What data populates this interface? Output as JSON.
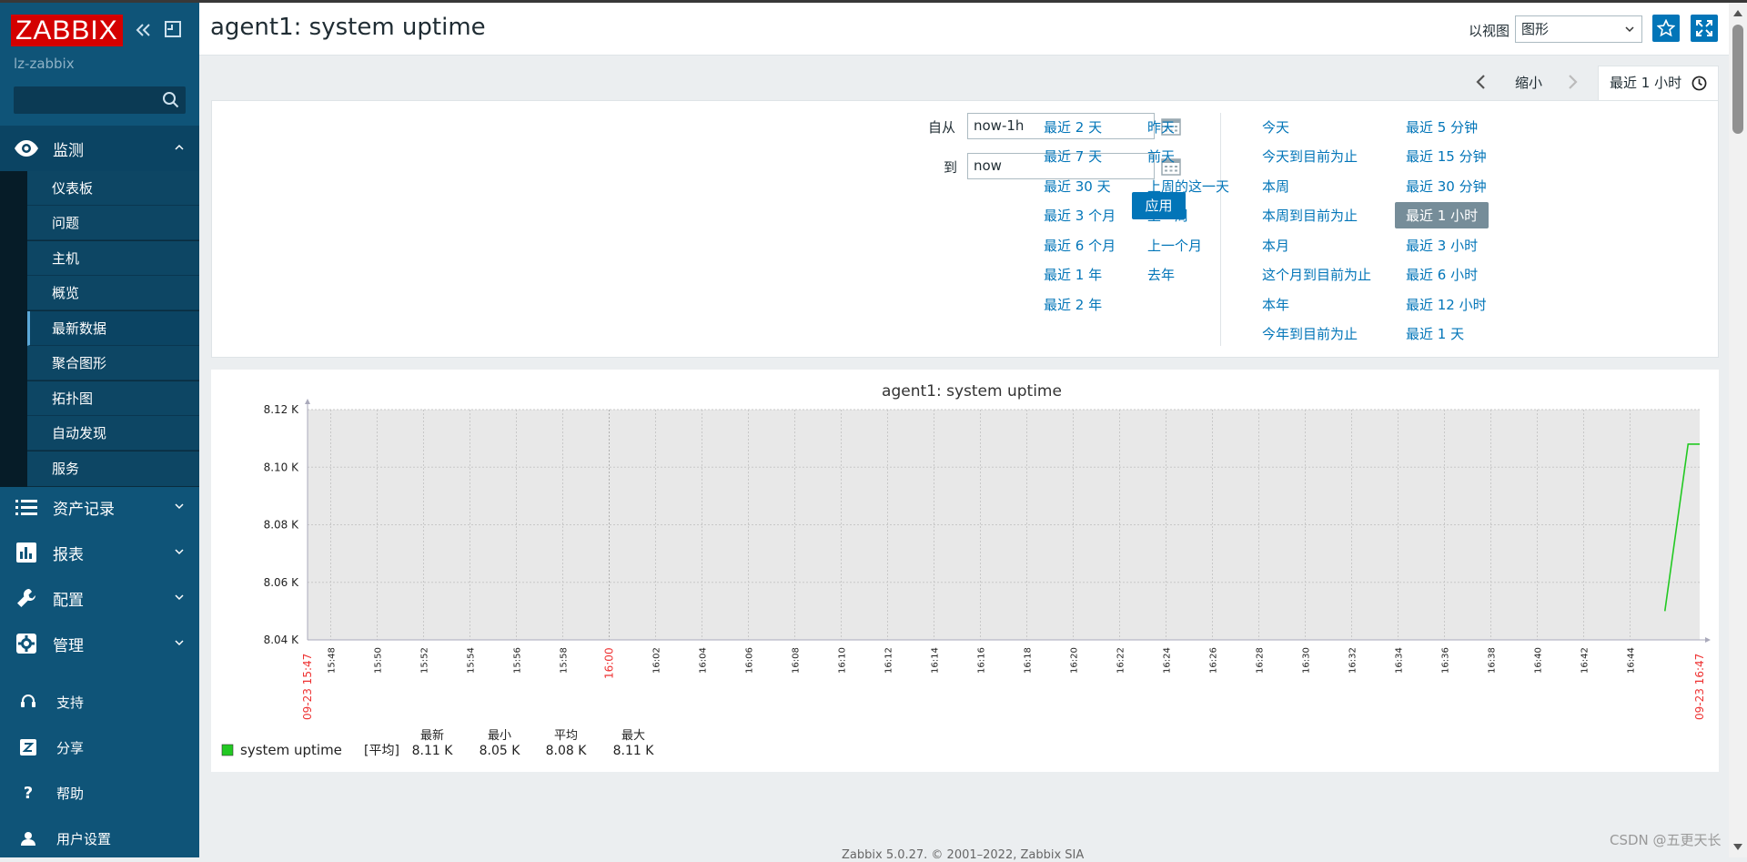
{
  "app": {
    "logo": "ZABBIX",
    "server_name": "lz-zabbix",
    "search_value": ""
  },
  "nav": {
    "monitoring": {
      "label": "监测",
      "items": [
        "仪表板",
        "问题",
        "主机",
        "概览",
        "最新数据",
        "聚合图形",
        "拓扑图",
        "自动发现",
        "服务"
      ],
      "selected": "最新数据"
    },
    "inventory": "资产记录",
    "reports": "报表",
    "config": "配置",
    "admin": "管理",
    "support": "支持",
    "share": "分享",
    "help": "帮助",
    "user_settings": "用户设置"
  },
  "header": {
    "title": "agent1: system uptime",
    "view_as_label": "以视图",
    "view_as_value": "图形"
  },
  "time_tab": {
    "zoom_out": "缩小",
    "range": "最近 1 小时"
  },
  "time_filter": {
    "from_label": "自从",
    "from_value": "now-1h",
    "to_label": "到",
    "to_value": "now",
    "apply": "应用",
    "quick": [
      [
        "最近 2 天",
        "最近 7 天",
        "最近 30 天",
        "最近 3 个月",
        "最近 6 个月",
        "最近 1 年",
        "最近 2 年"
      ],
      [
        "昨天",
        "前天",
        "上周的这一天",
        "上一周",
        "上一个月",
        "去年"
      ],
      [
        "今天",
        "今天到目前为止",
        "本周",
        "本周到目前为止",
        "本月",
        "这个月到目前为止",
        "本年",
        "今年到目前为止"
      ],
      [
        "最近 5 分钟",
        "最近 15 分钟",
        "最近 30 分钟",
        "最近 1 小时",
        "最近 3 小时",
        "最近 6 小时",
        "最近 12 小时",
        "最近 1 天"
      ]
    ],
    "selected_quick": "最近 1 小时"
  },
  "chart_data": {
    "type": "line",
    "title": "agent1: system uptime",
    "y_unit": "K",
    "ylim": [
      8.04,
      8.12
    ],
    "y_ticks": [
      "8.12 K",
      "8.10 K",
      "8.08 K",
      "8.06 K",
      "8.04 K"
    ],
    "x_range": [
      "15:47",
      "16:47"
    ],
    "x_ticks": [
      "15:48",
      "15:50",
      "15:52",
      "15:54",
      "15:56",
      "15:58",
      "16:00",
      "16:02",
      "16:04",
      "16:06",
      "16:08",
      "16:10",
      "16:12",
      "16:14",
      "16:16",
      "16:18",
      "16:20",
      "16:22",
      "16:24",
      "16:26",
      "16:28",
      "16:30",
      "16:32",
      "16:34",
      "16:36",
      "16:38",
      "16:40",
      "16:42",
      "16:44"
    ],
    "x_start_label": "09-23 15:47",
    "x_end_label": "09-23 16:47",
    "highlight_tick": "16:00",
    "grid": true,
    "series": [
      {
        "name": "system uptime",
        "color": "#22c922",
        "points": [
          [
            "16:45.5",
            8.05
          ],
          [
            "16:46.5",
            8.108
          ],
          [
            "16:47",
            8.108
          ]
        ]
      }
    ],
    "legend": {
      "name": "system uptime",
      "func_label": "[平均]",
      "col_headers": [
        "最新",
        "最小",
        "平均",
        "最大"
      ],
      "values": [
        "8.11 K",
        "8.05 K",
        "8.08 K",
        "8.11 K"
      ]
    }
  },
  "footer": "Zabbix 5.0.27. © 2001–2022, Zabbix SIA",
  "watermark": "CSDN @五更天长"
}
